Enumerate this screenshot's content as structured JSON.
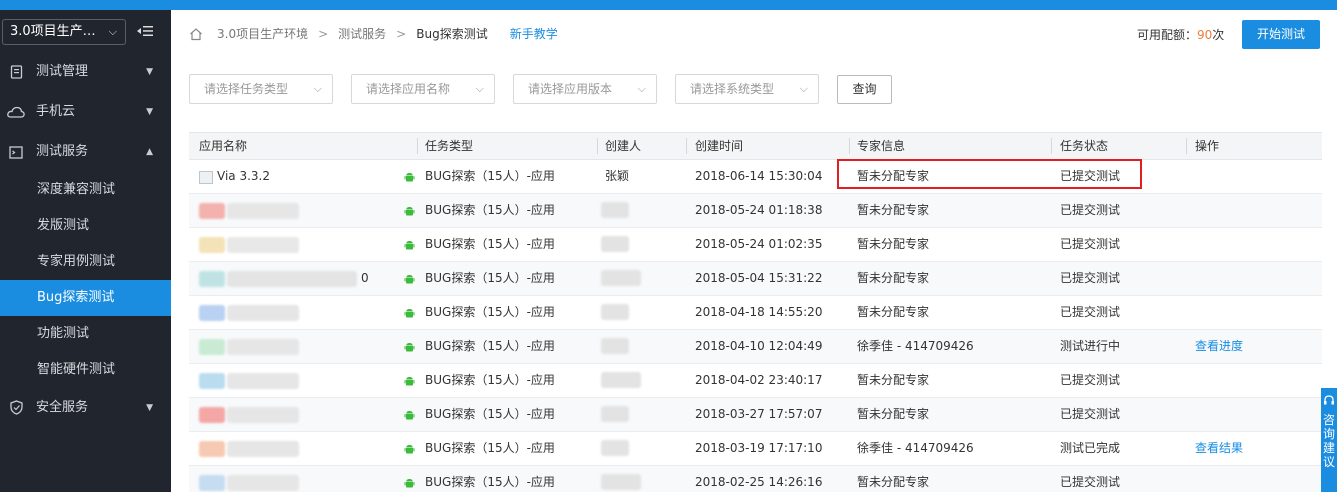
{
  "sidebar": {
    "project_select": "3.0项目生产…",
    "menu": [
      {
        "label": "测试管理",
        "icon": "document-icon",
        "expanded": false
      },
      {
        "label": "手机云",
        "icon": "cloud-icon",
        "expanded": false
      },
      {
        "label": "测试服务",
        "icon": "terminal-icon",
        "expanded": true
      }
    ],
    "sub_items": [
      "深度兼容测试",
      "发版测试",
      "专家用例测试",
      "Bug探索测试",
      "功能测试",
      "智能硬件测试"
    ],
    "active_sub": "Bug探索测试",
    "security": {
      "label": "安全服务",
      "icon": "shield-icon"
    }
  },
  "breadcrumb": {
    "items": [
      "3.0项目生产环境",
      "测试服务",
      "Bug探索测试"
    ],
    "tutorial_link": "新手教学"
  },
  "quota": {
    "label": "可用配额：",
    "value": "90",
    "unit": "次"
  },
  "start_button": "开始测试",
  "filters": {
    "task_type": "请选择任务类型",
    "app_name": "请选择应用名称",
    "app_version": "请选择应用版本",
    "system_type": "请选择系统类型",
    "query_button": "查询"
  },
  "table": {
    "headers": [
      "应用名称",
      "任务类型",
      "创建人",
      "创建时间",
      "专家信息",
      "任务状态",
      "操作"
    ],
    "rows": [
      {
        "app": "Via 3.3.2",
        "type": "BUG探索（15人）-应用",
        "creator": "张颖",
        "time": "2018-06-14 15:30:04",
        "expert": "暂未分配专家",
        "status": "已提交测试",
        "action": ""
      },
      {
        "app": "",
        "type": "BUG探索（15人）-应用",
        "creator": "",
        "time": "2018-05-24 01:18:38",
        "expert": "暂未分配专家",
        "status": "已提交测试",
        "action": ""
      },
      {
        "app": "",
        "type": "BUG探索（15人）-应用",
        "creator": "",
        "time": "2018-05-24 01:02:35",
        "expert": "暂未分配专家",
        "status": "已提交测试",
        "action": ""
      },
      {
        "app": "0",
        "type": "BUG探索（15人）-应用",
        "creator": "",
        "time": "2018-05-04 15:31:22",
        "expert": "暂未分配专家",
        "status": "已提交测试",
        "action": ""
      },
      {
        "app": "",
        "type": "BUG探索（15人）-应用",
        "creator": "",
        "time": "2018-04-18 14:55:20",
        "expert": "暂未分配专家",
        "status": "已提交测试",
        "action": ""
      },
      {
        "app": "",
        "type": "BUG探索（15人）-应用",
        "creator": "",
        "time": "2018-04-10 12:04:49",
        "expert": "徐季佳 - 414709426",
        "status": "测试进行中",
        "action": "查看进度"
      },
      {
        "app": "",
        "type": "BUG探索（15人）-应用",
        "creator": "",
        "time": "2018-04-02 23:40:17",
        "expert": "暂未分配专家",
        "status": "已提交测试",
        "action": ""
      },
      {
        "app": "",
        "type": "BUG探索（15人）-应用",
        "creator": "",
        "time": "2018-03-27 17:57:07",
        "expert": "暂未分配专家",
        "status": "已提交测试",
        "action": ""
      },
      {
        "app": "",
        "type": "BUG探索（15人）-应用",
        "creator": "",
        "time": "2018-03-19 17:17:10",
        "expert": "徐季佳 - 414709426",
        "status": "测试已完成",
        "action": "查看结果"
      },
      {
        "app": "",
        "type": "BUG探索（15人）-应用",
        "creator": "",
        "time": "2018-02-25 14:26:16",
        "expert": "暂未分配专家",
        "status": "已提交测试",
        "action": ""
      }
    ]
  },
  "side_tab": "咨询建议",
  "colors": {
    "accent": "#1a8de1",
    "sidebar_bg": "#21252d",
    "quota_number": "#f07b3b",
    "highlight": "#e02020"
  }
}
